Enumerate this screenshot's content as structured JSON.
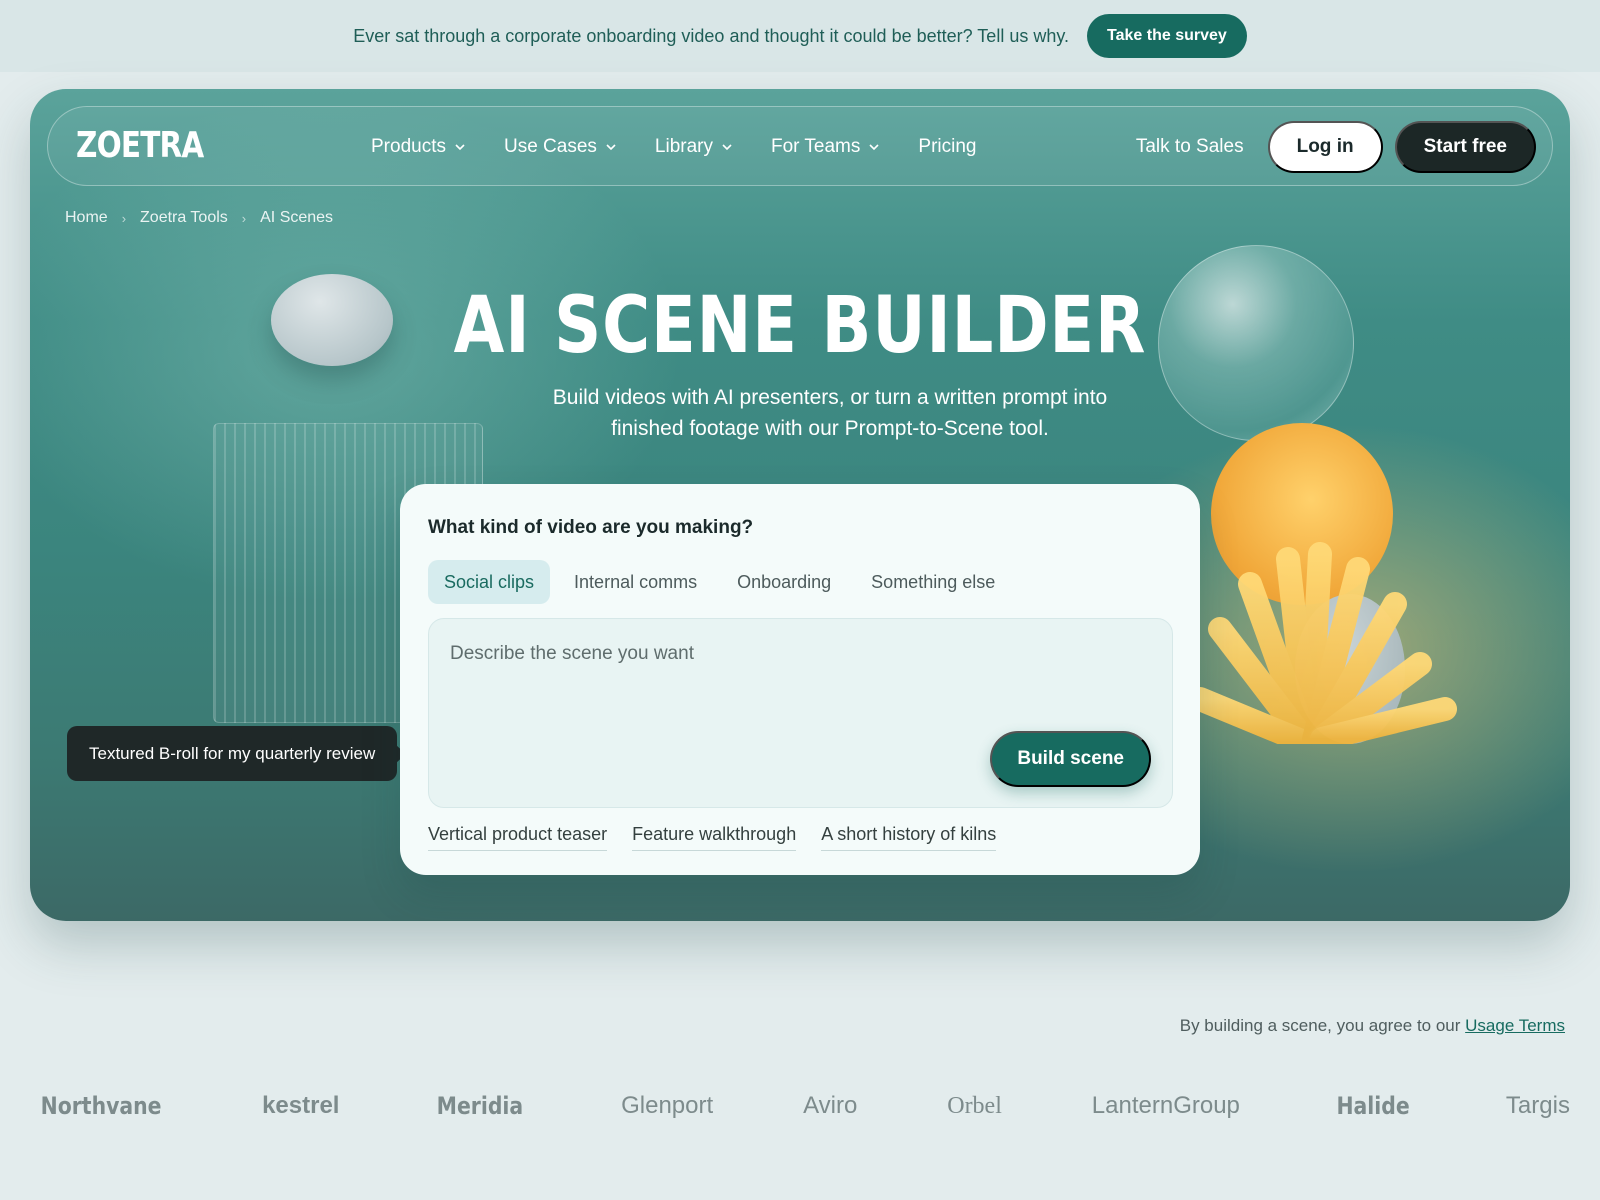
{
  "announcement": {
    "text": "Ever sat through a corporate onboarding video and thought it could be better? Tell us why.",
    "button": "Take the survey"
  },
  "nav": {
    "logo": "ZOETRA",
    "menu": [
      {
        "label": "Products",
        "has_dropdown": true,
        "icon": "chevron-down-icon"
      },
      {
        "label": "Use Cases",
        "has_dropdown": true,
        "icon": "chevron-down-icon"
      },
      {
        "label": "Library",
        "has_dropdown": true,
        "icon": "chevron-down-icon"
      },
      {
        "label": "For Teams",
        "has_dropdown": true,
        "icon": "chevron-down-icon"
      },
      {
        "label": "Pricing",
        "has_dropdown": false
      }
    ],
    "talk_to_sales": "Talk to Sales",
    "login": "Log in",
    "start": "Start free"
  },
  "breadcrumb": [
    "Home",
    "Zoetra Tools",
    "AI Scenes"
  ],
  "hero": {
    "title": "AI SCENE BUILDER",
    "subtitle_line1": "Build videos with AI presenters, or turn a written prompt into",
    "subtitle_line2": "finished footage with our Prompt-to-Scene tool."
  },
  "tooltip": "Textured B-roll for my quarterly review",
  "builder": {
    "question": "What kind of video are you making?",
    "tabs": [
      {
        "label": "Social clips",
        "active": true
      },
      {
        "label": "Internal comms",
        "active": false
      },
      {
        "label": "Onboarding",
        "active": false
      },
      {
        "label": "Something else",
        "active": false
      }
    ],
    "prompt_placeholder": "Describe the scene you want",
    "build_button": "Build scene",
    "suggestions": [
      "Vertical product teaser",
      "Feature walkthrough",
      "A short history of kilns"
    ]
  },
  "terms": {
    "prefix": "By building a scene, you agree to our",
    "link": "Usage Terms"
  },
  "brands": [
    "Northvane",
    "kestrel",
    "Meridia",
    "Glenport",
    "Aviro",
    "Orbel",
    "LanternGroup",
    "Halide",
    "Targis"
  ],
  "colors": {
    "accent": "#176b60",
    "dark_button": "#1c2726",
    "page_bg": "#e3eced"
  }
}
